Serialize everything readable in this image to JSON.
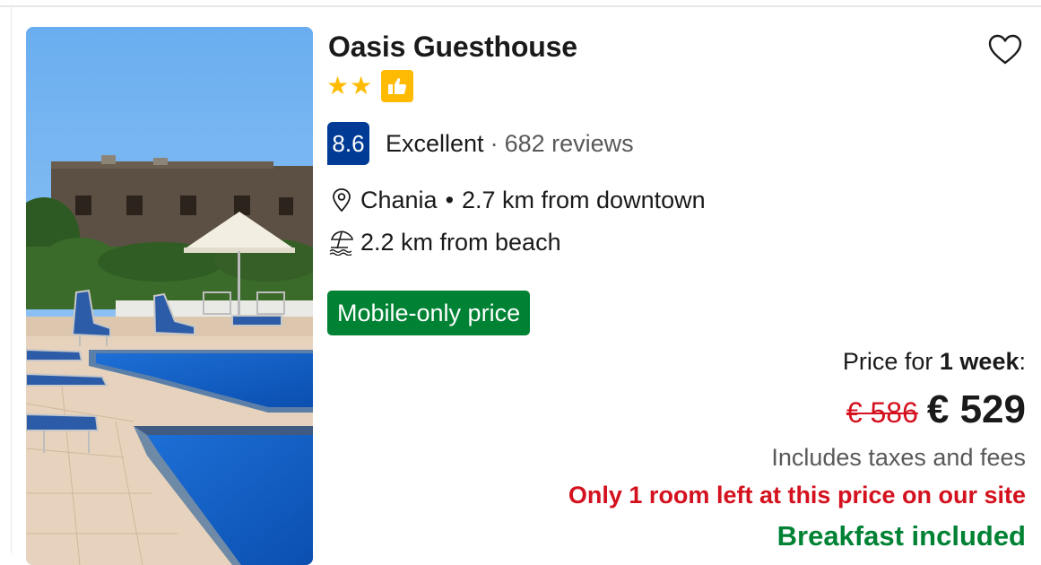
{
  "property": {
    "name": "Oasis Guesthouse",
    "stars": 2,
    "favorite_icon": "heart-outline-icon",
    "badge_icon": "thumbs-up-icon"
  },
  "review": {
    "score": "8.6",
    "word": "Excellent",
    "separator": "·",
    "count": "682 reviews"
  },
  "location": {
    "city": "Chania",
    "bullet": "•",
    "distance": "2.7 km from downtown",
    "beach": "2.2 km from beach"
  },
  "deal": {
    "badge": "Mobile-only price"
  },
  "pricing": {
    "label_prefix": "Price for ",
    "duration": "1 week",
    "label_suffix": ":",
    "original": "€ 586",
    "current": "€ 529",
    "taxes": "Includes taxes and fees",
    "scarcity": "Only 1 room left at this price on our site",
    "breakfast": "Breakfast included"
  },
  "colors": {
    "brand_blue": "#003b95",
    "star_yellow": "#febb02",
    "deal_green": "#008234",
    "urgent_red": "#d4111e"
  }
}
